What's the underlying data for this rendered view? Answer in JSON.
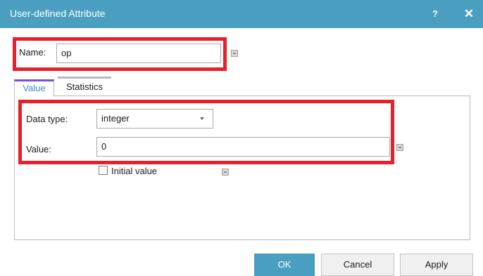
{
  "window": {
    "title": "User-defined Attribute",
    "help_label": "?",
    "close_label": "✕"
  },
  "name_field": {
    "label": "Name:",
    "value": "op"
  },
  "tabs": [
    {
      "label": "Value",
      "active": true
    },
    {
      "label": "Statistics",
      "active": false
    }
  ],
  "value_tab": {
    "data_type_label": "Data type:",
    "data_type_value": "integer",
    "value_label": "Value:",
    "value_value": "0",
    "initial_value_label": "Initial value",
    "initial_value_checked": false
  },
  "buttons": {
    "ok": "OK",
    "cancel": "Cancel",
    "apply": "Apply"
  },
  "colors": {
    "titlebar": "#4a9fc0",
    "highlight": "#e8202a",
    "active_tab_text": "#3a8fc6",
    "active_tab_accent": "#7a4fd6"
  }
}
